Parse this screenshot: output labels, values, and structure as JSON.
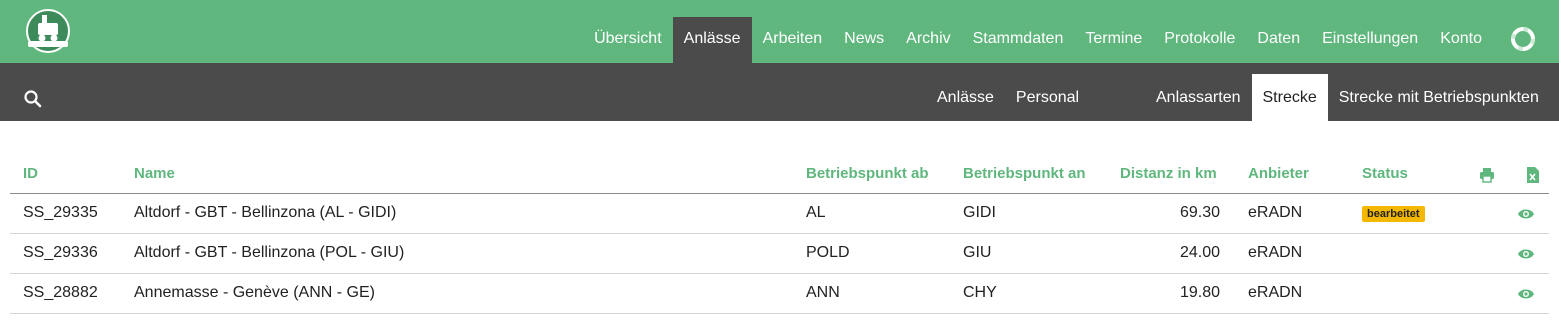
{
  "topnav": {
    "items": [
      {
        "label": "Übersicht",
        "active": false
      },
      {
        "label": "Anlässe",
        "active": true
      },
      {
        "label": "Arbeiten",
        "active": false
      },
      {
        "label": "News",
        "active": false
      },
      {
        "label": "Archiv",
        "active": false
      },
      {
        "label": "Stammdaten",
        "active": false
      },
      {
        "label": "Termine",
        "active": false
      },
      {
        "label": "Protokolle",
        "active": false
      },
      {
        "label": "Daten",
        "active": false
      },
      {
        "label": "Einstellungen",
        "active": false
      },
      {
        "label": "Konto",
        "active": false
      }
    ],
    "help_icon": "lifebuoy-icon",
    "logo_icon": "locomotive-logo"
  },
  "subnav": {
    "search_icon": "search-icon",
    "left_items": [
      {
        "label": "Anlässe",
        "active": false
      },
      {
        "label": "Personal",
        "active": false
      }
    ],
    "right_items": [
      {
        "label": "Anlassarten",
        "active": false
      },
      {
        "label": "Strecke",
        "active": true
      },
      {
        "label": "Strecke mit Betriebspunkten",
        "active": false
      }
    ]
  },
  "table": {
    "headers": {
      "id": "ID",
      "name": "Name",
      "ab": "Betriebspunkt ab",
      "an": "Betriebspunkt an",
      "distance": "Distanz in km",
      "provider": "Anbieter",
      "status": "Status"
    },
    "header_icons": [
      "print-icon",
      "excel-export-icon"
    ],
    "rows": [
      {
        "id": "SS_29335",
        "name": "Altdorf - GBT - Bellinzona (AL - GIDI)",
        "ab": "AL",
        "an": "GIDI",
        "distance": "69.30",
        "provider": "eRADN",
        "status": "bearbeitet"
      },
      {
        "id": "SS_29336",
        "name": "Altdorf - GBT - Bellinzona (POL - GIU)",
        "ab": "POLD",
        "an": "GIU",
        "distance": "24.00",
        "provider": "eRADN",
        "status": ""
      },
      {
        "id": "SS_28882",
        "name": "Annemasse - Genève (ANN - GE)",
        "ab": "ANN",
        "an": "CHY",
        "distance": "19.80",
        "provider": "eRADN",
        "status": ""
      }
    ]
  },
  "colors": {
    "brand_green": "#5fb77d",
    "dark_bar": "#4b4b4b",
    "status_badge": "#f5b800"
  }
}
